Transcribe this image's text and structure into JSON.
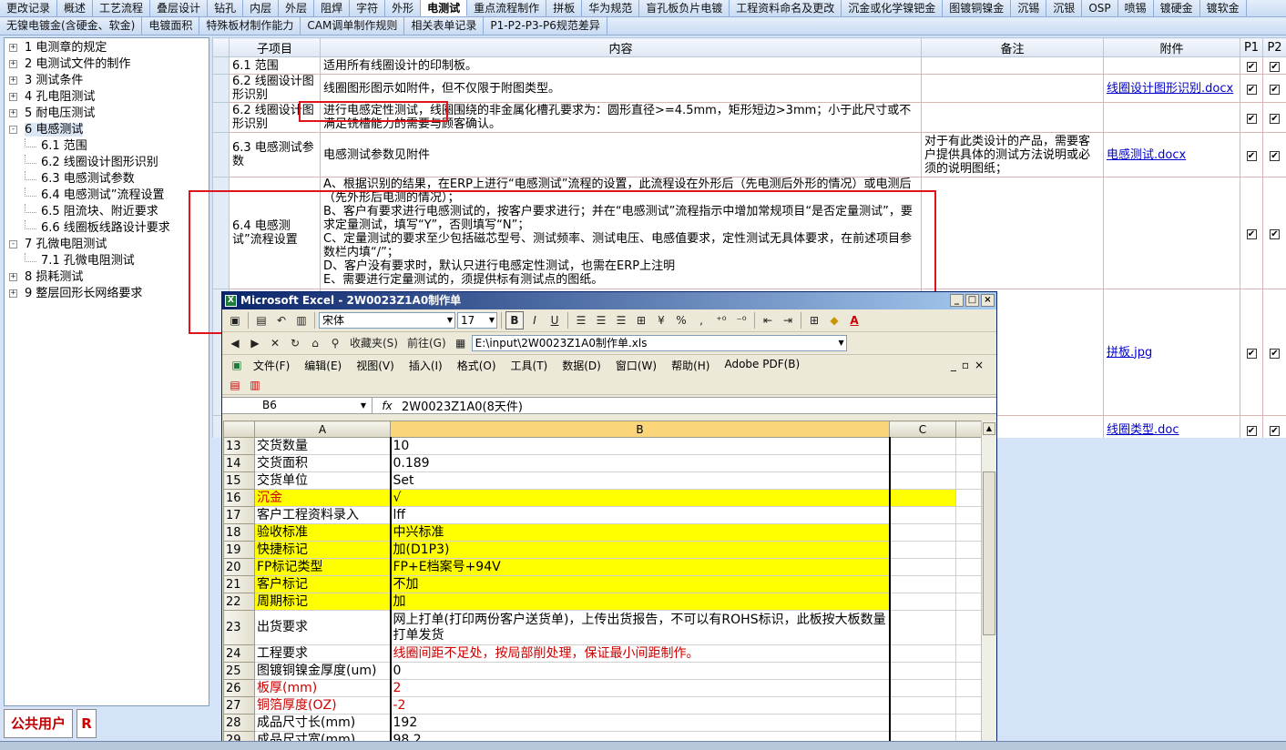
{
  "tabs_row1": [
    "更改记录",
    "概述",
    "工艺流程",
    "叠层设计",
    "钻孔",
    "内层",
    "外层",
    "阻焊",
    "字符",
    "外形",
    "电测试",
    "重点流程制作",
    "拼板",
    "华为规范",
    "盲孔板负片电镀",
    "工程资料命名及更改",
    "沉金或化学镍钯金",
    "图镀铜镍金",
    "沉锡",
    "沉银",
    "OSP",
    "喷锡",
    "镀硬金",
    "镀软金"
  ],
  "tabs_row1_active": "电测试",
  "tabs_row2": [
    "无镍电镀金(含硬金、软金)",
    "电镀面积",
    "特殊板材制作能力",
    "CAM调单制作规则",
    "相关表单记录",
    "P1-P2-P3-P6规范差异"
  ],
  "tree": [
    {
      "label": "1  电测章的规定",
      "level": 0,
      "expander": "+"
    },
    {
      "label": "2  电测试文件的制作",
      "level": 0,
      "expander": "+"
    },
    {
      "label": "3  测试条件",
      "level": 0,
      "expander": "+"
    },
    {
      "label": "4  孔电阻测试",
      "level": 0,
      "expander": "+"
    },
    {
      "label": "5  耐电压测试",
      "level": 0,
      "expander": "+"
    },
    {
      "label": "6  电感测试",
      "level": 0,
      "expander": "-",
      "selected": true
    },
    {
      "label": "6.1  范围",
      "level": 1
    },
    {
      "label": "6.2  线圈设计图形识别",
      "level": 1
    },
    {
      "label": "6.3  电感测试参数",
      "level": 1
    },
    {
      "label": "6.4  电感测试”流程设置",
      "level": 1
    },
    {
      "label": "6.5  阻流块、附近要求",
      "level": 1
    },
    {
      "label": "6.6  线圈板线路设计要求",
      "level": 1
    },
    {
      "label": "7  孔微电阻测试",
      "level": 0,
      "expander": "-"
    },
    {
      "label": "7.1  孔微电阻测试",
      "level": 1
    },
    {
      "label": "8  损耗测试",
      "level": 0,
      "expander": "+"
    },
    {
      "label": "9  整层回形长网络要求",
      "level": 0,
      "expander": "+"
    }
  ],
  "grid": {
    "headers": {
      "sub": "子项目",
      "content": "内容",
      "note": "备注",
      "attach": "附件",
      "p1": "P1",
      "p2": "P2"
    },
    "rows": [
      {
        "sub": "6.1  范围",
        "content": "适用所有线圈设计的印制板。",
        "note": "",
        "attach": "",
        "p1": "✔",
        "p2": "✔"
      },
      {
        "sub": "6.2  线圈设计图形识别",
        "content": "线圈图形图示如附件，但不仅限于附图类型。",
        "note": "",
        "attach": "线圈设计图形识别.docx",
        "p1": "✔",
        "p2": "✔"
      },
      {
        "sub": "6.2  线圈设计图形识别",
        "content": "进行电感定性测试，线圈围绕的非金属化槽孔要求为：圆形直径>=4.5mm，矩形短边>3mm；小于此尺寸或不满足铣槽能力的需要与顾客确认。",
        "note": "",
        "attach": "",
        "p1": "✔",
        "p2": "✔"
      },
      {
        "sub": "6.3  电感测试参数",
        "content": "电感测试参数见附件",
        "note": "对于有此类设计的产品，需要客户提供具体的测试方法说明或必须的说明图纸；",
        "attach": "电感测试.docx",
        "p1": "✔",
        "p2": "✔"
      },
      {
        "sub": "6.4  电感测试”流程设置",
        "content": "A、根据识别的结果，在ERP上进行“电感测试”流程的设置，此流程设在外形后（先电测后外形的情况）或电测后（先外形后电测的情况）；\nB、客户有要求进行电感测试的，按客户要求进行；并在“电感测试”流程指示中增加常规项目“是否定量测试”，要求定量测试，填写“Y”，否则填写“N”；\nC、定量测试的要求至少包括磁芯型号、测试频率、测试电压、电感值要求，定性测试无具体要求，在前述项目参数栏内填“/”；\nD、客户没有要求时，默认只进行电感定性测试，也需在ERP上注明\nE、需要进行定量测试的，须提供标有测试点的图纸。",
        "note": "",
        "attach": "",
        "p1": "✔",
        "p2": "✔"
      },
      {
        "sub": "",
        "content": "",
        "note": "",
        "attach": "拼板.jpg",
        "p1": "✔",
        "p2": "✔"
      },
      {
        "sub": "",
        "content": "",
        "note": "",
        "attach": "线圈类型.doc",
        "p1": "✔",
        "p2": "✔"
      }
    ]
  },
  "excel": {
    "title": "Microsoft Excel - 2W0023Z1A0制作单",
    "title_buttons": [
      "_",
      "□",
      "×"
    ],
    "font_name": "宋体",
    "font_size": "17",
    "format_buttons": {
      "bold": "B",
      "italic": "I",
      "underline": "U",
      "percent": "%",
      "comma": ","
    },
    "web": {
      "favorites": "收藏夹(S)",
      "go": "前往(G)",
      "address": "E:\\input\\2W0023Z1A0制作单.xls"
    },
    "menu": [
      "文件(F)",
      "编辑(E)",
      "视图(V)",
      "插入(I)",
      "格式(O)",
      "工具(T)",
      "数据(D)",
      "窗口(W)",
      "帮助(H)",
      "Adobe PDF(B)"
    ],
    "name_box": "B6",
    "fx": "fx",
    "formula": "2W0023Z1A0(8天件)",
    "col_headers": [
      "A",
      "B",
      "C"
    ],
    "rows": [
      {
        "n": "13",
        "a": "交货数量",
        "b": "10"
      },
      {
        "n": "14",
        "a": "交货面积",
        "b": "0.189"
      },
      {
        "n": "15",
        "a": "交货单位",
        "b": "Set"
      },
      {
        "n": "16",
        "a": "沉金",
        "b": "√",
        "yellow": true,
        "redA": true,
        "yellowC": true
      },
      {
        "n": "17",
        "a": "客户工程资料录入",
        "b": "lff"
      },
      {
        "n": "18",
        "a": "验收标准",
        "b": "中兴标准",
        "yellow": true
      },
      {
        "n": "19",
        "a": "快捷标记",
        "b": "加(D1P3)",
        "yellow": true
      },
      {
        "n": "20",
        "a": "FP标记类型",
        "b": "FP+E档案号+94V",
        "yellow": true
      },
      {
        "n": "21",
        "a": "客户标记",
        "b": "不加",
        "yellow": true
      },
      {
        "n": "22",
        "a": "周期标记",
        "b": "加",
        "yellow": true
      },
      {
        "n": "23",
        "a": "出货要求",
        "b": "网上打单(打印两份客户送货单)，上传出货报告，不可以有ROHS标识，此板按大板数量打单发货",
        "tall": true
      },
      {
        "n": "24",
        "a": "工程要求",
        "b": "线圈间距不足处，按局部削处理，保证最小间距制作。",
        "redB": true
      },
      {
        "n": "25",
        "a": "图镀铜镍金厚度(um)",
        "b": "0"
      },
      {
        "n": "26",
        "a": "板厚(mm)",
        "b": "2",
        "redA": true,
        "redB": true
      },
      {
        "n": "27",
        "a": "铜箔厚度(OZ)",
        "b": "-2",
        "redA": true,
        "redB": true
      },
      {
        "n": "28",
        "a": "成品尺寸长(mm)",
        "b": "192"
      },
      {
        "n": "29",
        "a": "成品尺寸宽(mm)",
        "b": "98.2"
      }
    ]
  },
  "status": {
    "user": "公共用户",
    "flag": "R"
  },
  "colors": {
    "accent": "#e0121a",
    "title_bar": "#0a246a",
    "highlight": "#ffff00",
    "link": "#0000cc"
  }
}
